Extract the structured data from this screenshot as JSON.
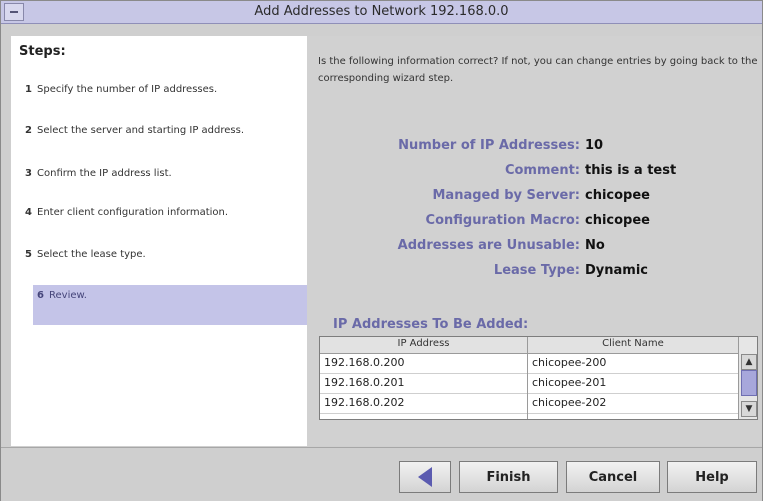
{
  "window": {
    "title": "Add Addresses to Network 192.168.0.0",
    "minimize_icon": "minus-icon"
  },
  "steps": {
    "heading": "Steps:",
    "items": [
      {
        "num": "1",
        "text": "Specify the number of IP addresses."
      },
      {
        "num": "2",
        "text": "Select the server and starting IP address."
      },
      {
        "num": "3",
        "text": "Confirm the IP address list."
      },
      {
        "num": "4",
        "text": "Enter client configuration information."
      },
      {
        "num": "5",
        "text": "Select the lease type."
      },
      {
        "num": "6",
        "text": "Review."
      }
    ]
  },
  "review": {
    "intro": "Is the following information correct?  If not, you can change entries by going back to the corresponding wizard step.",
    "fields": [
      {
        "label": "Number of IP Addresses:",
        "value": "10"
      },
      {
        "label": "Comment:",
        "value": "this is a test"
      },
      {
        "label": "Managed by Server:",
        "value": "chicopee"
      },
      {
        "label": "Configuration Macro:",
        "value": "chicopee"
      },
      {
        "label": "Addresses are Unusable:",
        "value": "No"
      },
      {
        "label": "Lease Type:",
        "value": "Dynamic"
      }
    ],
    "list_heading": "IP Addresses To Be Added:",
    "table": {
      "headers": [
        "IP Address",
        "Client Name"
      ],
      "rows": [
        [
          "192.168.0.200",
          "chicopee-200"
        ],
        [
          "192.168.0.201",
          "chicopee-201"
        ],
        [
          "192.168.0.202",
          "chicopee-202"
        ]
      ]
    }
  },
  "buttons": {
    "back_icon": "left-arrow-icon",
    "finish": "Finish",
    "cancel": "Cancel",
    "help": "Help"
  },
  "colors": {
    "accent": "#6a6aa8",
    "selected_step_bg": "#c4c4e8"
  }
}
